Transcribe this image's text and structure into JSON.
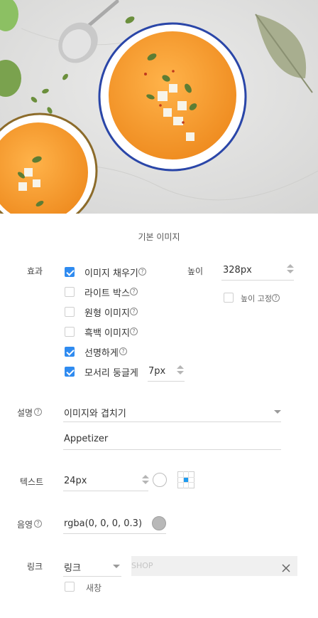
{
  "photo": {
    "alt": "soup-bowls-photo"
  },
  "caption": "기본 이미지",
  "effect": {
    "label": "효과",
    "options": [
      {
        "label": "이미지 채우기",
        "checked": true
      },
      {
        "label": "라이트 박스",
        "checked": false
      },
      {
        "label": "원형 이미지",
        "checked": false
      },
      {
        "label": "흑백 이미지",
        "checked": false
      },
      {
        "label": "선명하게",
        "checked": true
      },
      {
        "label": "모서리 둥글게",
        "checked": true
      }
    ],
    "radius_value": "7px"
  },
  "height": {
    "label": "높이",
    "value": "328px",
    "fixed_label": "높이 고정",
    "fixed_checked": false
  },
  "description": {
    "label": "설명",
    "mode": "이미지와 겹치기",
    "text": "Appetizer"
  },
  "text_settings": {
    "label": "텍스트",
    "size": "24px"
  },
  "shadow": {
    "label": "음영",
    "value": "rgba(0, 0, 0, 0.3)"
  },
  "link": {
    "label": "링크",
    "type": "링크",
    "value": "SHOP",
    "new_window_label": "새창",
    "new_window_checked": false
  },
  "colors": {
    "accent": "#2f8bf0",
    "soup": "#f39a2a",
    "bowl_rim": "#2a46a8"
  }
}
